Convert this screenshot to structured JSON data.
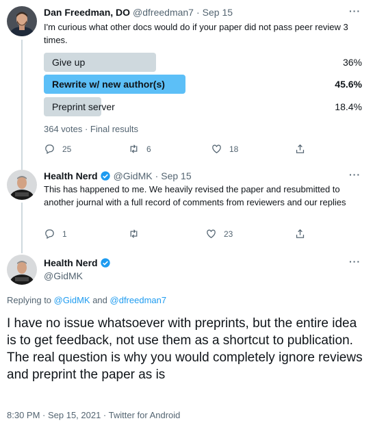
{
  "tweet1": {
    "author_name": "Dan Freedman, DO",
    "handle": "@dfreedman7",
    "date": "Sep 15",
    "text": "I'm curious what other docs would do if your paper did not pass peer review 3 times.",
    "poll": {
      "options": [
        {
          "label": "Give up",
          "percent_text": "36%",
          "fraction": 0.36,
          "winner": false
        },
        {
          "label": "Rewrite w/ new author(s)",
          "percent_text": "45.6%",
          "fraction": 0.456,
          "winner": true
        },
        {
          "label": "Preprint server",
          "percent_text": "18.4%",
          "fraction": 0.184,
          "winner": false
        }
      ],
      "summary": "364 votes · Final results"
    },
    "actions": {
      "replies": "25",
      "retweets": "6",
      "likes": "18"
    }
  },
  "tweet2": {
    "author_name": "Health Nerd",
    "handle": "@GidMK",
    "date": "Sep 15",
    "text": "This has happened to me. We heavily revised the paper and resubmitted to another journal with a full record of comments from reviewers and our replies",
    "actions": {
      "replies": "1",
      "retweets": "",
      "likes": "23"
    }
  },
  "tweet3": {
    "author_name": "Health Nerd",
    "handle": "@GidMK",
    "replying_prefix": "Replying to ",
    "replying_user1": "@GidMK",
    "replying_and": " and ",
    "replying_user2": "@dfreedman7",
    "text": "I have no issue whatsoever with preprints, but the entire idea is to get feedback, not use them as a shortcut to publication. The real question is why you would completely ignore reviews and preprint the paper as is",
    "timestamp": "8:30 PM · Sep 15, 2021 · Twitter for Android"
  },
  "colors": {
    "accent": "#1d9bf0",
    "poll_winner": "#5cbff7",
    "poll_other": "#cfd9de"
  },
  "icons": [
    "reply-icon",
    "retweet-icon",
    "like-icon",
    "share-icon",
    "more-icon",
    "verified-badge-icon"
  ]
}
